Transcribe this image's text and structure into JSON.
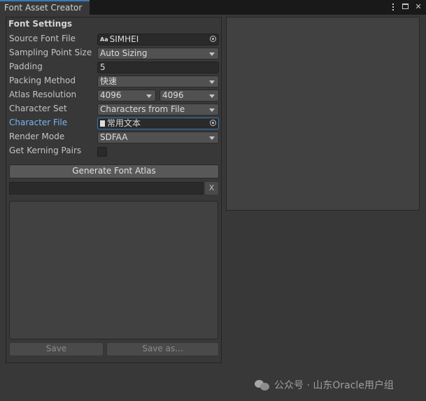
{
  "window": {
    "tab_title": "Font Asset Creator",
    "icons": [
      "more-options-icon",
      "maximize-icon",
      "close-icon"
    ],
    "close_glyph": "✕"
  },
  "settings": {
    "section_title": "Font Settings",
    "source_font_file": {
      "label": "Source Font File",
      "value": "SIMHEI",
      "icon": "font-asset-icon",
      "icon_text": "Aa"
    },
    "sampling_point_size": {
      "label": "Sampling Point Size",
      "value": "Auto Sizing"
    },
    "padding": {
      "label": "Padding",
      "value": "5"
    },
    "packing_method": {
      "label": "Packing Method",
      "value": "快速"
    },
    "atlas_resolution": {
      "label": "Atlas Resolution",
      "width": "4096",
      "height": "4096"
    },
    "character_set": {
      "label": "Character Set",
      "value": "Characters from File"
    },
    "character_file": {
      "label": "Character File",
      "value": "常用文本",
      "icon": "text-asset-icon"
    },
    "render_mode": {
      "label": "Render Mode",
      "value": "SDFAA"
    },
    "get_kerning_pairs": {
      "label": "Get Kerning Pairs",
      "checked": false
    }
  },
  "actions": {
    "generate_label": "Generate Font Atlas",
    "progress": 0,
    "clear_label": "X",
    "save_label": "Save",
    "save_as_label": "Save as..."
  },
  "colors": {
    "accent": "#3a79bb",
    "background": "#383838",
    "field_dark": "#2a2a2a",
    "dropdown": "#515151"
  },
  "watermark": {
    "text": "公众号 · 山东Oracle用户组"
  }
}
